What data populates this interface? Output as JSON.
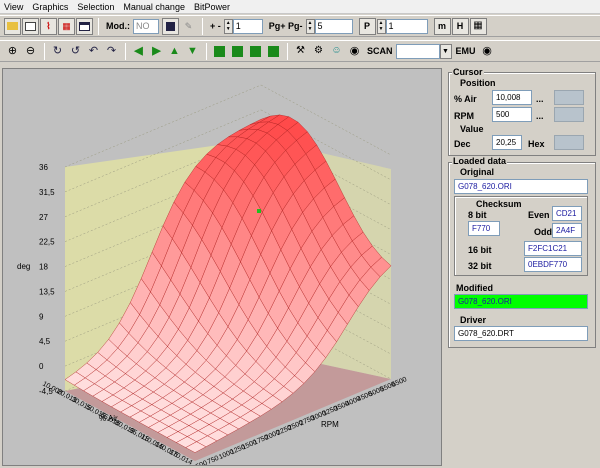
{
  "menu": [
    "View",
    "Graphics",
    "Selection",
    "Manual change",
    "BitPower"
  ],
  "toolbar1": {
    "mod_label": "Mod.:",
    "mod_value": "NO",
    "plus_minus_label": "+ -",
    "plus_minus_value": "1",
    "pg_label": "Pg+ Pg-",
    "pg_value": "5",
    "p_icon_label": "P",
    "p_value": "1",
    "m_icon_label": "m",
    "h_icon_label": "H"
  },
  "toolbar2": {
    "scan_label": "SCAN",
    "scan_value": "",
    "emu_label": "EMU"
  },
  "chart_data": {
    "type": "surface3d",
    "ylabel": "deg",
    "xlabel": "% Air",
    "zlabel": "RPM",
    "y_ticks": [
      "36",
      "31,5",
      "27",
      "22,5",
      "18",
      "13,5",
      "9",
      "4,5",
      "0",
      "-4,5"
    ],
    "ylim": [
      -4.5,
      36
    ],
    "air_ticks": [
      "10,008",
      "20,015",
      "30,015",
      "50,015",
      "65,015",
      "80,015",
      "95,015",
      "110,015",
      "140,015",
      "170,014"
    ],
    "rpm_ticks": [
      "500",
      "750",
      "1000",
      "1250",
      "1500",
      "1750",
      "2000",
      "2250",
      "2500",
      "2750",
      "3000",
      "3250",
      "3500",
      "4000",
      "4500",
      "5000",
      "5500",
      "6500"
    ],
    "surface_color": "#ff3030",
    "floor_color": "#c39a9a",
    "wall_color": "#dcdca8"
  },
  "cursor": {
    "title": "Cursor",
    "position_label": "Position",
    "air_label": "% Air",
    "air_value": "10,008",
    "rpm_label": "RPM",
    "rpm_value": "500",
    "dots": "...",
    "value_label": "Value",
    "dec_label": "Dec",
    "dec_value": "20,25",
    "hex_label": "Hex"
  },
  "loaded": {
    "title": "Loaded data",
    "original_label": "Original",
    "original_file": "G078_620.ORI",
    "checksum_label": "Checksum",
    "bit8_label": "8 bit",
    "bit8_value": "F770",
    "even_label": "Even",
    "even_value": "CD21",
    "odd_label": "Odd",
    "odd_value": "2A4F",
    "bit16_label": "16 bit",
    "bit16_value": "F2FC1C21",
    "bit32_label": "32 bit",
    "bit32_value": "0EBDF770",
    "modified_label": "Modified",
    "modified_file": "G078_620.ORI",
    "driver_label": "Driver",
    "driver_file": "G078_620.DRT"
  }
}
